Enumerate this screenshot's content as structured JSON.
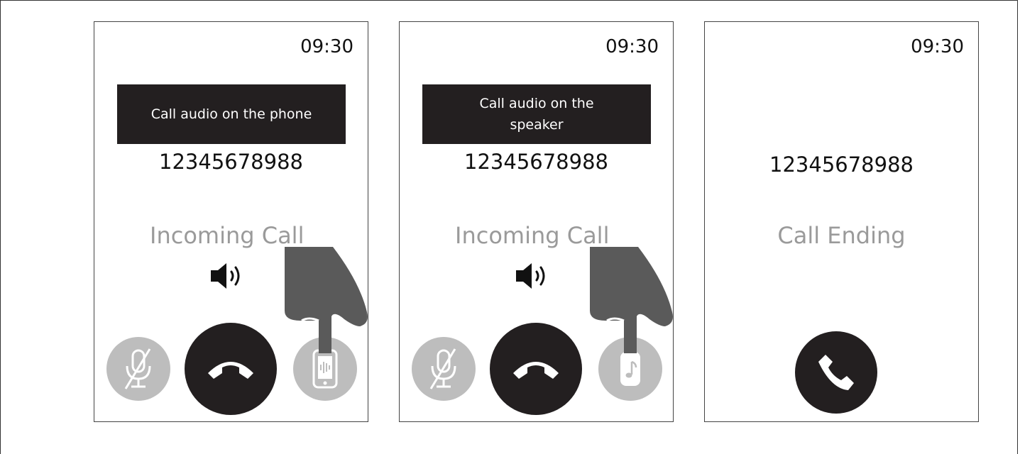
{
  "screens": [
    {
      "clock": "09:30",
      "banner": "Call audio on the phone",
      "number": "12345678988",
      "status": "Incoming Call",
      "audio_icon": "phone-audio-icon"
    },
    {
      "clock": "09:30",
      "banner": "Call audio on the speaker",
      "number": "12345678988",
      "status": "Incoming Call",
      "audio_icon": "speaker-audio-icon"
    },
    {
      "clock": "09:30",
      "number": "12345678988",
      "status": "Call Ending"
    }
  ],
  "colors": {
    "dark": "#231f20",
    "muted_button": "#bdbdbd",
    "muted_text": "#9a9a9a",
    "hand": "#5a5a5a"
  }
}
